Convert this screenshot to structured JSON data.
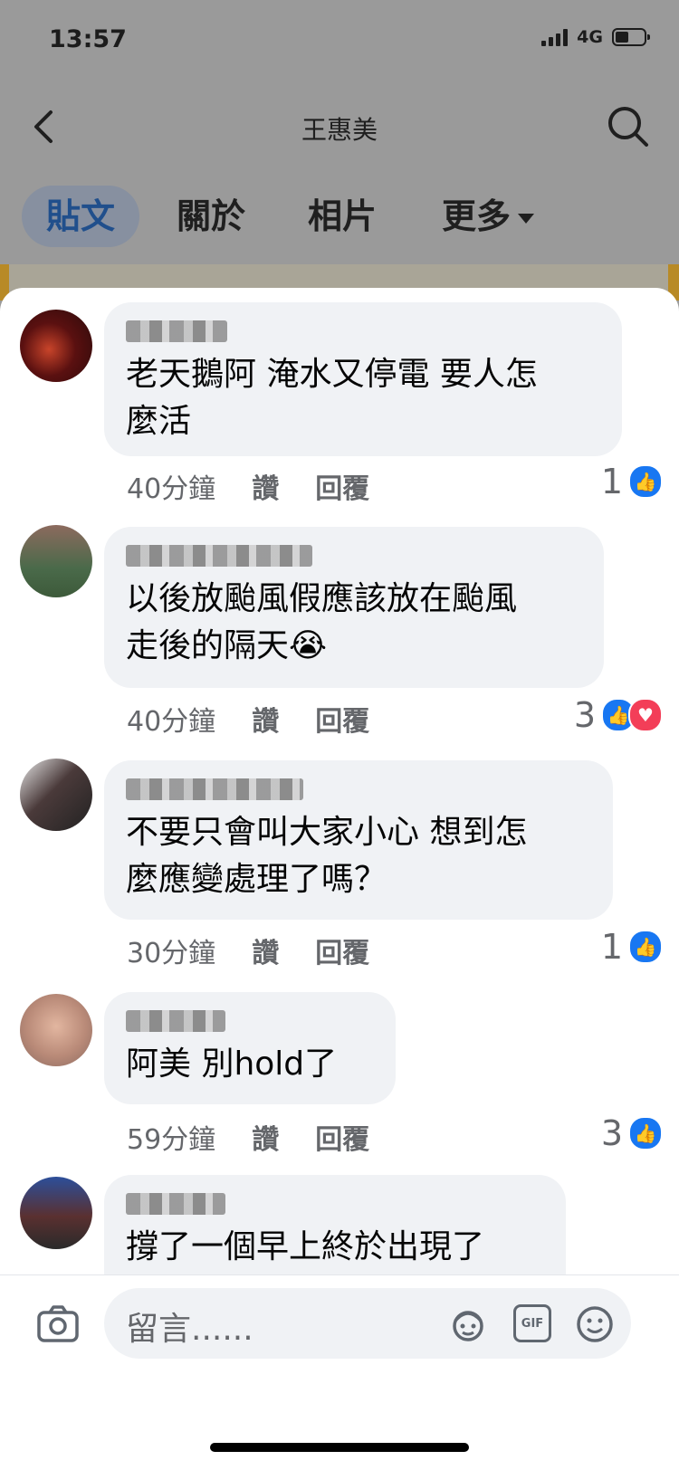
{
  "status": {
    "time": "13:57",
    "network": "4G"
  },
  "header": {
    "title": "王惠美",
    "back_icon": "chevron-left-icon",
    "search_icon": "search-icon"
  },
  "tabs": [
    {
      "label": "貼文",
      "active": true
    },
    {
      "label": "關於",
      "active": false
    },
    {
      "label": "相片",
      "active": false
    },
    {
      "label": "更多",
      "active": false
    }
  ],
  "comments": [
    {
      "text": "老天鵝阿 淹水又停電 要人怎\n麼活",
      "time": "40分鐘",
      "like_label": "讚",
      "reply_label": "回覆",
      "reaction_count": "1",
      "reactions": [
        "like"
      ]
    },
    {
      "text": "以後放颱風假應該放在颱風\n走後的隔天😭",
      "time": "40分鐘",
      "like_label": "讚",
      "reply_label": "回覆",
      "reaction_count": "3",
      "reactions": [
        "like",
        "love"
      ]
    },
    {
      "text": "不要只會叫大家小心 想到怎\n麼應變處理了嗎？",
      "time": "30分鐘",
      "like_label": "讚",
      "reply_label": "回覆",
      "reaction_count": "1",
      "reactions": [
        "like"
      ]
    },
    {
      "text": "阿美 別hold了",
      "time": "59分鐘",
      "like_label": "讚",
      "reply_label": "回覆",
      "reaction_count": "3",
      "reactions": [
        "like"
      ]
    },
    {
      "text": "撐了一個早上終於出現了",
      "time": "",
      "like_label": "",
      "reply_label": "",
      "reaction_count": "",
      "reactions": []
    }
  ],
  "input": {
    "placeholder": "留言......",
    "icons": [
      "camera-icon",
      "avatar-sticker-icon",
      "gif-icon",
      "emoji-icon"
    ],
    "gif_label": "GIF"
  },
  "colors": {
    "like": "#1877f2",
    "love": "#f33e58",
    "bubble": "#f0f2f5",
    "active_tab_text": "#204f8c"
  }
}
